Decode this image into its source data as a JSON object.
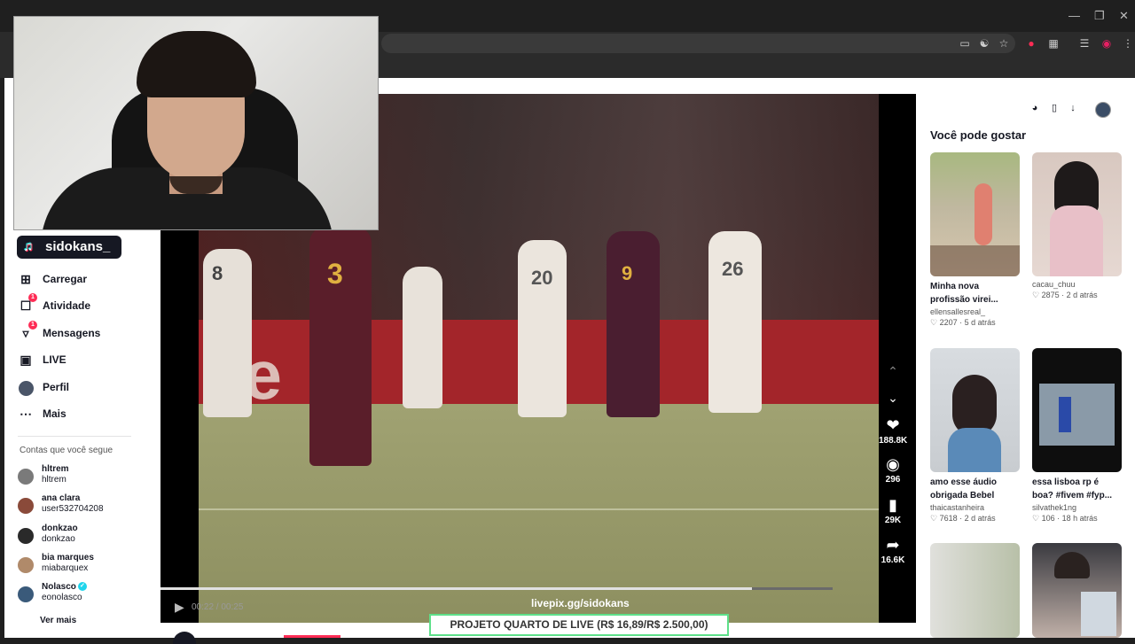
{
  "sidebar": {
    "logo_user": "sidokans_",
    "nav": [
      {
        "label": "Carregar",
        "icon": "plus-square-icon"
      },
      {
        "label": "Atividade",
        "icon": "message-icon",
        "badge": "1"
      },
      {
        "label": "Mensagens",
        "icon": "send-icon",
        "badge": "1"
      },
      {
        "label": "LIVE",
        "icon": "live-icon"
      },
      {
        "label": "Perfil",
        "icon": "profile-avatar"
      },
      {
        "label": "Mais",
        "icon": "more-icon"
      }
    ],
    "following_title": "Contas que você segue",
    "following": [
      {
        "name": "hltrem",
        "handle": "hltrem"
      },
      {
        "name": "ana clara",
        "handle": "user532704208"
      },
      {
        "name": "donkzao",
        "handle": "donkzao"
      },
      {
        "name": "bia marques",
        "handle": "miabarquex"
      },
      {
        "name": "Nolasco",
        "handle": "eonolasco",
        "verified": true
      }
    ],
    "see_more": "Ver mais"
  },
  "video": {
    "time": "00:22 / 00:25",
    "progress": 0.88,
    "likes": "188.8K",
    "comments": "296",
    "saves": "29K",
    "shares": "16.6K",
    "overlay_url": "livepix.gg/sidokans",
    "live_bar": "PROJETO QUARTO DE LIVE (R$ 16,89/R$ 2.500,00)",
    "board_text": "de",
    "jersey_numbers": [
      "3",
      "20",
      "9",
      "26",
      "8"
    ]
  },
  "recommend": {
    "title": "Você pode gostar",
    "cards": [
      {
        "title": "Minha nova profissão virei...",
        "author": "ellensallesreal_",
        "likes": "2207",
        "time": "5 d atrás"
      },
      {
        "title": "",
        "author": "cacau_chuu",
        "likes": "2875",
        "time": "2 d atrás"
      },
      {
        "title": "amo esse áudio obrigada Bebel",
        "author": "thaicastanheira",
        "likes": "7618",
        "time": "2 d atrás"
      },
      {
        "title": "essa lisboa rp é boa? #fivem #fyp...",
        "author": "silvathek1ng",
        "likes": "106",
        "time": "18 h atrás"
      }
    ]
  }
}
